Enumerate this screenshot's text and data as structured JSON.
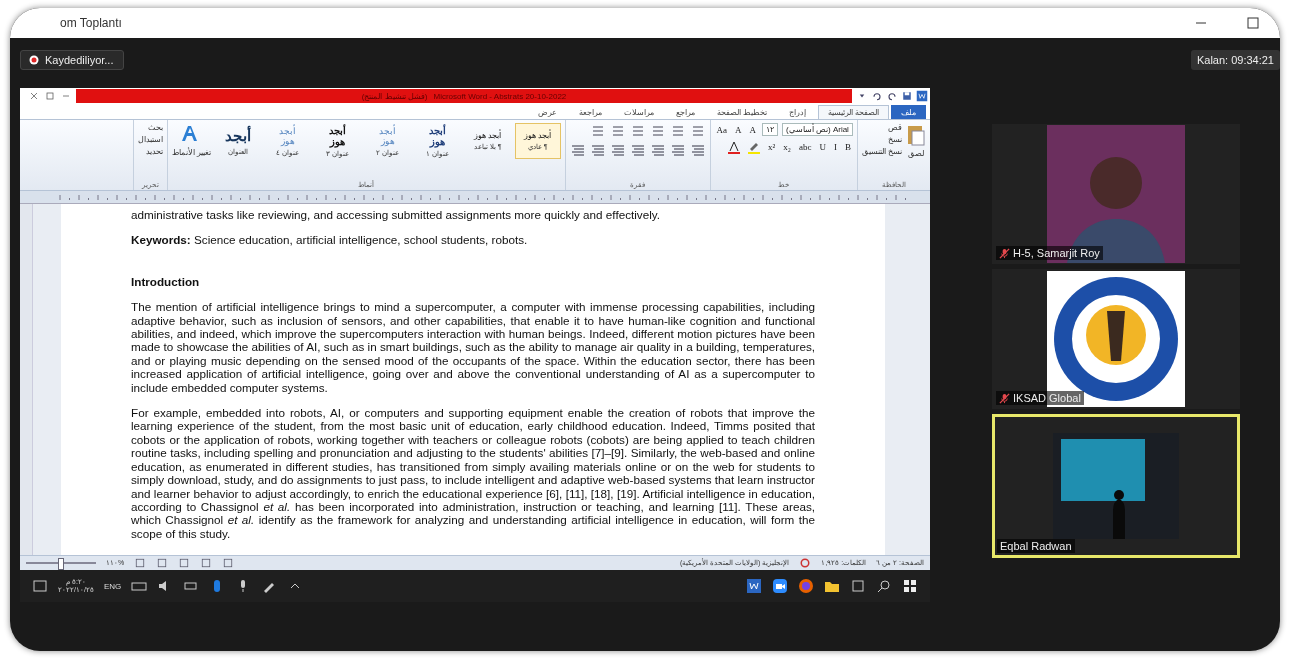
{
  "window": {
    "title": "om Toplantı"
  },
  "recording": {
    "label": "Kaydediliyor..."
  },
  "timer": "Kalan: 09:34:21",
  "word": {
    "title": "Microsoft Word - Abstrats 20-10-2022",
    "title_note": "(فشل تنشيط المنتج)",
    "tabs": [
      {
        "label": "ملف",
        "kind": "file",
        "selected": false
      },
      {
        "label": "الصفحة الرئيسية",
        "kind": "tab",
        "selected": true
      },
      {
        "label": "إدراج",
        "kind": "tab",
        "selected": false
      },
      {
        "label": "تخطيط الصفحة",
        "kind": "tab",
        "selected": false
      },
      {
        "label": "مراجع",
        "kind": "tab",
        "selected": false
      },
      {
        "label": "مراسلات",
        "kind": "tab",
        "selected": false
      },
      {
        "label": "مراجعة",
        "kind": "tab",
        "selected": false
      },
      {
        "label": "عرض",
        "kind": "tab",
        "selected": false
      }
    ],
    "clipboard": {
      "label": "الحافظة",
      "paste": "لصق",
      "items": [
        "قص",
        "نسخ",
        "نسخ التنسيق"
      ]
    },
    "font": {
      "label": "خط",
      "name": "Arial (نص أساسي)",
      "size": "١٢",
      "top_buttons": [
        "A",
        "A",
        "Aa"
      ],
      "format_buttons": [
        "B",
        "I",
        "U",
        "abc",
        "x₂",
        "x²"
      ]
    },
    "paragraph": {
      "label": "فقرة"
    },
    "styles": {
      "label": "أنماط",
      "change": "تغيير الأنماط",
      "items": [
        {
          "sample": "أبجد هوز",
          "name": "¶ عادي",
          "kind": "normal",
          "selected": true
        },
        {
          "sample": "أبجد هوز",
          "name": "¶ بلا تباعد",
          "kind": "normal",
          "selected": false
        },
        {
          "sample": "أبجد هوز",
          "name": "عنوان ١",
          "kind": "heading",
          "selected": false
        },
        {
          "sample": "أبجد هوز",
          "name": "عنوان ٢",
          "kind": "subheading",
          "selected": false
        },
        {
          "sample": "أبجد هوز",
          "name": "عنوان ٣",
          "kind": "strong",
          "selected": false
        },
        {
          "sample": "أبجد هوز",
          "name": "عنوان ٤",
          "kind": "subheading",
          "selected": false
        },
        {
          "sample": "أبجد",
          "name": "العنوان",
          "kind": "title",
          "selected": false
        }
      ]
    },
    "editing": {
      "label": "تحرير",
      "items": [
        "بحث",
        "استبدال",
        "تحديد"
      ]
    },
    "document": [
      {
        "kind": "body",
        "text": "administrative tasks like reviewing, and accessing submitted assignments more quickly and effectively."
      },
      {
        "kind": "body",
        "text": "**Keywords:** Science education, artificial intelligence, school students, robots."
      },
      {
        "kind": "heading",
        "text": "Introduction"
      },
      {
        "kind": "body",
        "text": "The mention of artificial intelligence brings to mind a supercomputer, a computer with immense processing capabilities, including adaptive behavior, such as inclusion of sensors, and other capabilities, that enable it to have human-like cognition and functional abilities, and indeed, which improve the supercomputers interaction with human beings. Indeed, different motion pictures have been made to showcase the abilities of AI, such as in smart buildings, such as the ability to manage air quality in a building, temperatures, and or playing music depending on the sensed mood of the occupants of the space. Within the education sector, there has been increased application of artificial intelligence, going over and above the conventional understanding of AI as a supercomputer to include embedded computer systems."
      },
      {
        "kind": "body",
        "text": "For example, embedded into robots, AI, or computers and supporting equipment enable the creation of robots that improve the learning experience of the student, from the most basic unit of education, early childhood education. Indeed, Timms posited that cobots or the application of robots, working together with teachers or colleague robots (cobots) are being applied to teach children routine tasks, including spelling and pronunciation and adjusting to the students' abilities [7]–[9]. Similarly, the web-based and online education, as enumerated in different studies, has transitioned from simply availing materials online or on the web for students to simply download, study, and do assignments to just pass, to include intelligent and adaptive web-based systems that learn instructor and learner behavior to adjust accordingly, to enrich the educational experience [6], [11], [18], [19]. Artificial intelligence in education, according to Chassignol *et al.* has been incorporated into administration, instruction or teaching, and learning [11]. These areas, which Chassignol *et al.* identify as the framework for analyzing and understanding artificial intelligence in education, will form the scope of this study."
      }
    ],
    "status_bar": {
      "page": "الصفحة: ٢ من ٦",
      "words": "الكلمات: ١,٩٢٥",
      "language": "الإنجليزية (الولايات المتحدة الأمريكية)",
      "zoom": "%١١٠",
      "zoom_slider": {
        "level": 0.45
      }
    },
    "taskbar": {
      "time": "٥:٢٠ م",
      "date": "٢٠٢٢/١٠/٢٥",
      "language": "ENG"
    }
  },
  "participants": [
    {
      "name": "H-5, Samarjit Roy",
      "kind": "photo",
      "muted": true,
      "speaking": false
    },
    {
      "name": "IKSAD Global",
      "kind": "logo",
      "muted": true,
      "speaking": false
    },
    {
      "name": "Eqbal Radwan",
      "kind": "video",
      "muted": false,
      "speaking": true
    }
  ]
}
